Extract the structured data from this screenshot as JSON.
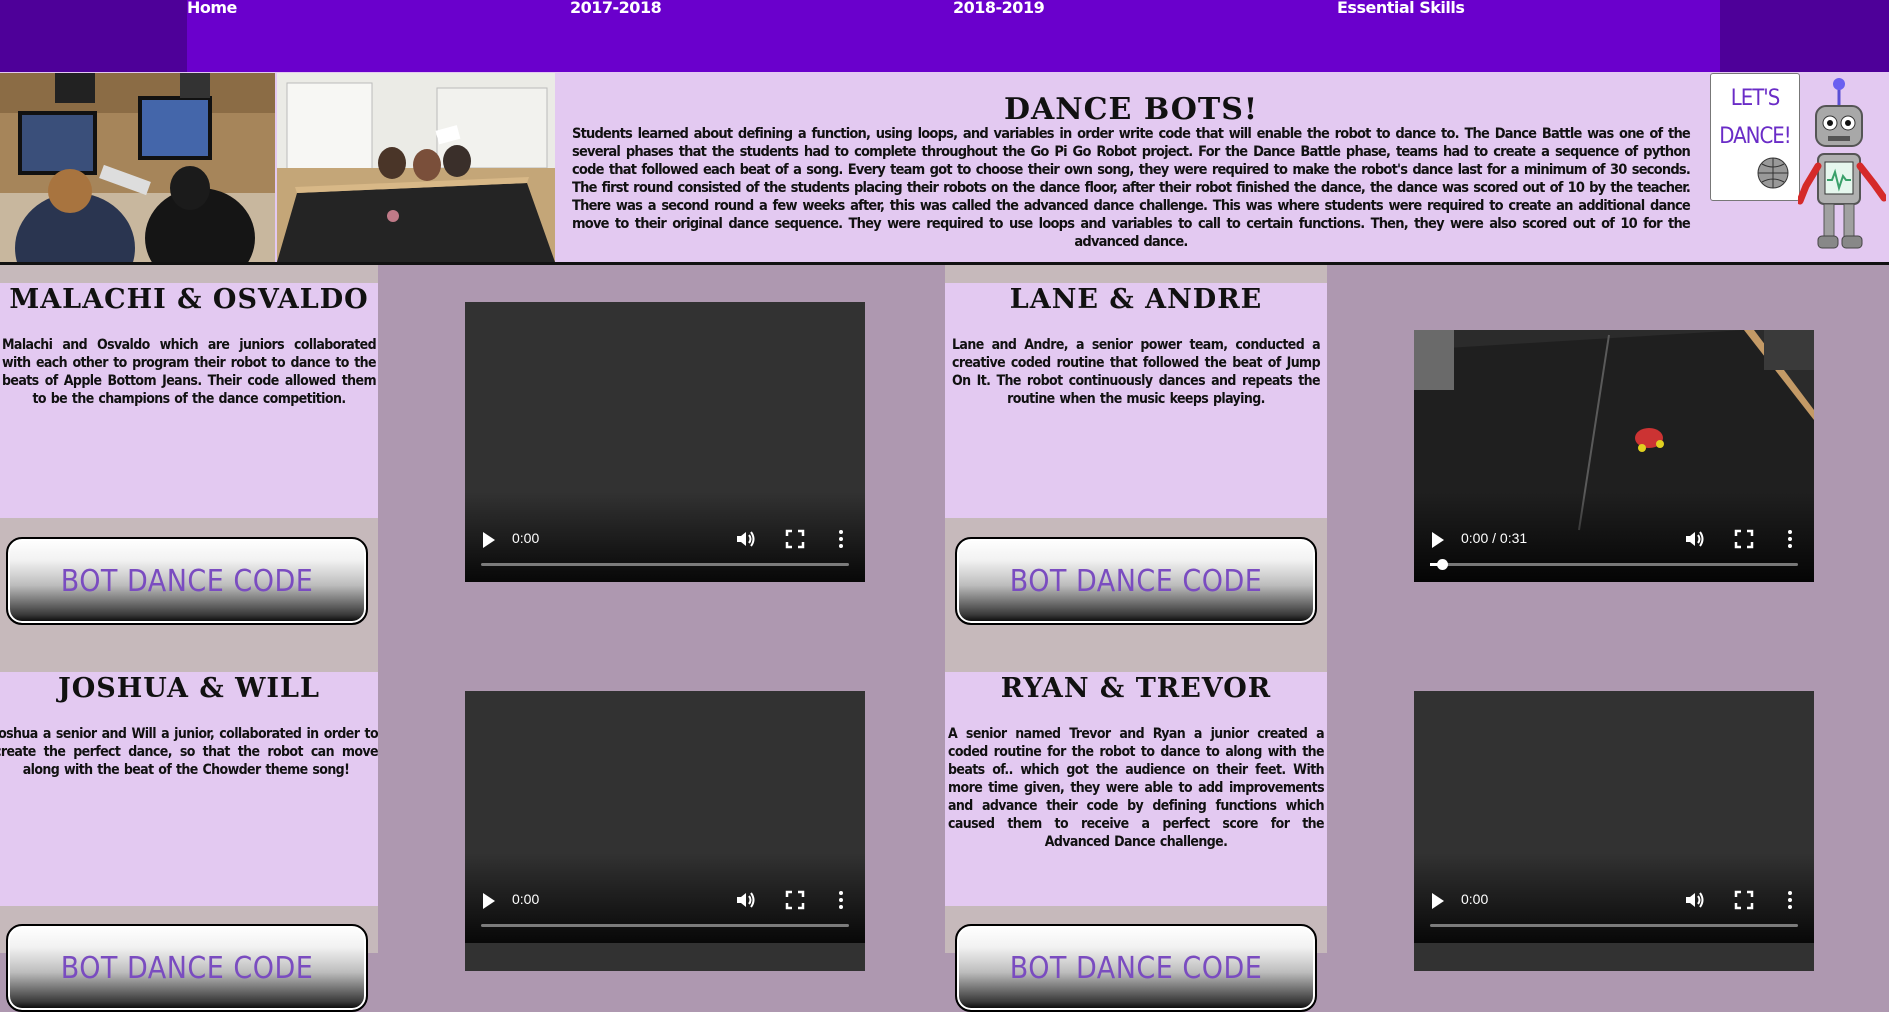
{
  "nav": {
    "items": [
      {
        "label": "Home"
      },
      {
        "label": "2017-2018"
      },
      {
        "label": "2018-2019"
      },
      {
        "label": "Essential Skills"
      }
    ]
  },
  "intro": {
    "title": "DANCE BOTS!",
    "text": "Students learned about defining a function, using loops, and variables in order write code that will enable the robot to dance to. The Dance Battle was one of the several phases that the students had to complete throughout the Go Pi Go Robot project. For the Dance Battle phase, teams had to create a sequence of python code that followed each beat of a song. Every team got to choose their own song, they were required to make the robot's dance last for a minimum of 30 seconds. The first round consisted of the students placing their robots on the dance floor, after their robot finished the dance, the dance was scored out of 10 by the teacher. There was a second round a few weeks after, this was called the advanced dance challenge. This was where students were required to create an additional dance move to their original dance sequence. They were required to use loops and variables to call to certain functions. Then, they were also scored out of 10 for the advanced dance."
  },
  "logo": {
    "line1": "LET'S",
    "line2": "DANCE!"
  },
  "teams": [
    {
      "name": "MALACHI & OSVALDO",
      "desc": "Malachi and Osvaldo which are juniors collaborated with each other to program their robot to dance to the beats of Apple Bottom Jeans. Their code allowed them to be the champions of the dance competition.",
      "button": "BOT DANCE CODE"
    },
    {
      "name": "LANE & ANDRE",
      "desc": "Lane and Andre, a senior power team, conducted a creative coded routine that followed the beat of Jump On It. The robot continuously dances and repeats the routine when the music keeps playing.",
      "button": "BOT DANCE CODE"
    },
    {
      "name": "JOSHUA & WILL",
      "desc": "Joshua a senior and Will a junior, collaborated in order to create the perfect dance, so that the robot can move along with the beat of the Chowder theme song!",
      "button": "BOT DANCE CODE"
    },
    {
      "name": "RYAN & TREVOR",
      "desc": "A senior named Trevor and Ryan a junior created a coded routine for the robot to dance to along with the beats of.. which got the audience on their feet. With more time given, they were able to add improvements and advance their code by defining functions which caused them to receive a perfect score for the Advanced Dance challenge.",
      "button": "BOT DANCE CODE"
    }
  ],
  "videos": [
    {
      "time": "0:00"
    },
    {
      "time": "0:00 / 0:31",
      "progress": 0.03
    },
    {
      "time": "0:00"
    },
    {
      "time": "0:00"
    }
  ],
  "colors": {
    "nav_outer": "#4e0099",
    "nav_inner": "#6a00cc",
    "card_bg": "#e3c9f1",
    "page_bg": "#ae98b0",
    "button_text": "#7a4cc0"
  }
}
